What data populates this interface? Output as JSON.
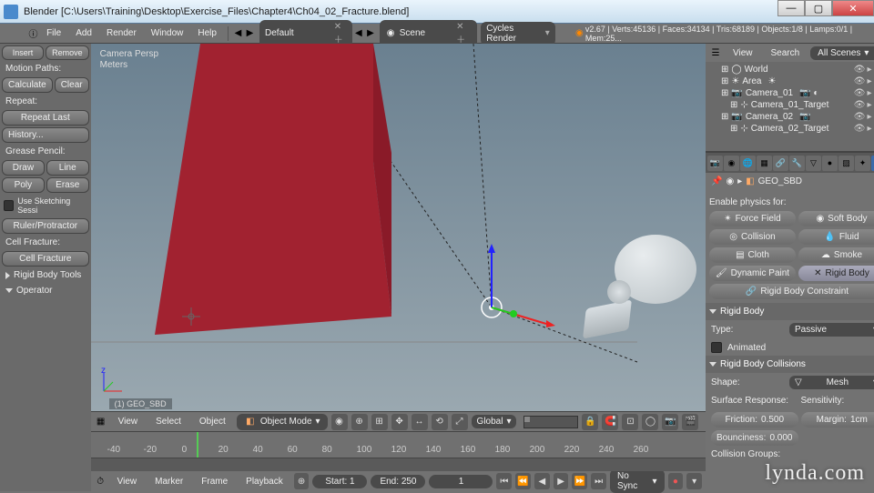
{
  "window": {
    "title": "Blender [C:\\Users\\Training\\Desktop\\Exercise_Files\\Chapter4\\Ch04_02_Fracture.blend]",
    "min": "—",
    "max": "▢",
    "close": "✕"
  },
  "menu": {
    "items": [
      "File",
      "Add",
      "Render",
      "Window",
      "Help"
    ],
    "layout": "Default",
    "scene": "Scene",
    "renderer": "Cycles Render",
    "stats": "v2.67 | Verts:45136 | Faces:34134 | Tris:68189 | Objects:1/8 | Lamps:0/1 | Mem:25..."
  },
  "left": {
    "insert": "Insert",
    "remove": "Remove",
    "motion_paths": "Motion Paths:",
    "calculate": "Calculate",
    "clear": "Clear",
    "repeat": "Repeat:",
    "repeat_last": "Repeat Last",
    "history": "History...",
    "grease": "Grease Pencil:",
    "draw": "Draw",
    "line": "Line",
    "poly": "Poly",
    "erase": "Erase",
    "sketch": "Use Sketching Sessi",
    "ruler": "Ruler/Protractor",
    "cell_fracture": "Cell Fracture:",
    "cell_fracture_btn": "Cell Fracture",
    "rigid_tools": "Rigid Body Tools",
    "operator": "Operator"
  },
  "viewport": {
    "label1": "Camera Persp",
    "label2": "Meters",
    "object_name": "(1) GEO_SBD",
    "menu": [
      "View",
      "Select",
      "Object"
    ],
    "mode": "Object Mode",
    "orient": "Global"
  },
  "timeline": {
    "menu": [
      "View",
      "Marker",
      "Frame",
      "Playback"
    ],
    "start_label": "Start:",
    "start": "1",
    "end_label": "End:",
    "end": "250",
    "current": "1",
    "sync": "No Sync",
    "ticks": [
      "-40",
      "-20",
      "0",
      "20",
      "40",
      "60",
      "80",
      "100",
      "120",
      "140",
      "160",
      "180",
      "200",
      "220",
      "240",
      "260"
    ]
  },
  "outliner": {
    "menu": [
      "View",
      "Search"
    ],
    "filter": "All Scenes",
    "items": [
      {
        "indent": 1,
        "icon": "◯",
        "name": "World"
      },
      {
        "indent": 1,
        "icon": "☀",
        "name": "Area",
        "extras": "☀"
      },
      {
        "indent": 1,
        "icon": "📷",
        "name": "Camera_01",
        "extras": "📷 ◐"
      },
      {
        "indent": 2,
        "icon": "⊹",
        "name": "Camera_01_Target"
      },
      {
        "indent": 1,
        "icon": "📷",
        "name": "Camera_02",
        "extras": "📷"
      },
      {
        "indent": 2,
        "icon": "⊹",
        "name": "Camera_02_Target"
      }
    ]
  },
  "props": {
    "crumb": "GEO_SBD",
    "enable_label": "Enable physics for:",
    "buttons": {
      "force": "Force Field",
      "soft": "Soft Body",
      "collision": "Collision",
      "fluid": "Fluid",
      "cloth": "Cloth",
      "smoke": "Smoke",
      "dynpaint": "Dynamic Paint",
      "rigid": "Rigid Body",
      "constraint": "Rigid Body Constraint"
    },
    "rigid_hdr": "Rigid Body",
    "type_label": "Type:",
    "type_value": "Passive",
    "animated": "Animated",
    "collisions_hdr": "Rigid Body Collisions",
    "shape_label": "Shape:",
    "shape_value": "Mesh",
    "surface_label": "Surface Response:",
    "sensitivity_label": "Sensitivity:",
    "friction_label": "Friction:",
    "friction": "0.500",
    "margin_label": "Margin:",
    "margin": "1cm",
    "bounce_label": "Bounciness:",
    "bounce": "0.000",
    "groups_label": "Collision Groups:"
  },
  "watermark": "lynda.com"
}
